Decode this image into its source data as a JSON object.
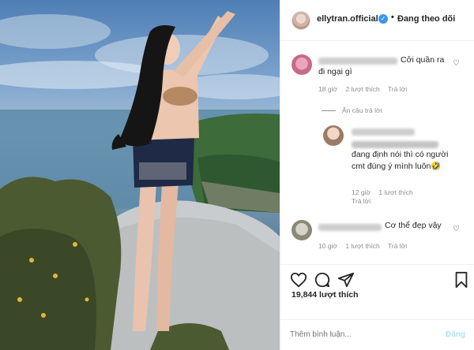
{
  "header": {
    "username": "ellytran.official",
    "verified_icon": "verified-badge-icon",
    "separator": "•",
    "follow_label": "Đang theo dõi"
  },
  "comments": [
    {
      "text": "Cởi quần ra đi ngại gì",
      "time": "18 giờ",
      "likes": "2 lượt thích",
      "reply": "Trả lời"
    },
    {
      "is_reply": true,
      "text": "đang định nói thì có người cmt đúng ý mình luôn🤣",
      "time": "12 giờ",
      "likes": "1 lượt thích",
      "reply": "Trả lời"
    },
    {
      "text": "Cơ thể đẹp vậy",
      "time": "10 giờ",
      "likes": "1 lượt thích",
      "reply": "Trả lời"
    }
  ],
  "hide_replies_label": "Ẩn câu trả lời",
  "actions": {
    "like_icon": "heart-icon",
    "comment_icon": "comment-icon",
    "share_icon": "send-icon",
    "save_icon": "bookmark-icon",
    "likes_count": "19,844 lượt thích"
  },
  "add_comment": {
    "placeholder": "Thêm bình luận...",
    "post_label": "Đăng"
  },
  "colors": {
    "accent": "#3897f0",
    "muted": "#8e8e8e",
    "post_disabled": "#b2dffc"
  }
}
